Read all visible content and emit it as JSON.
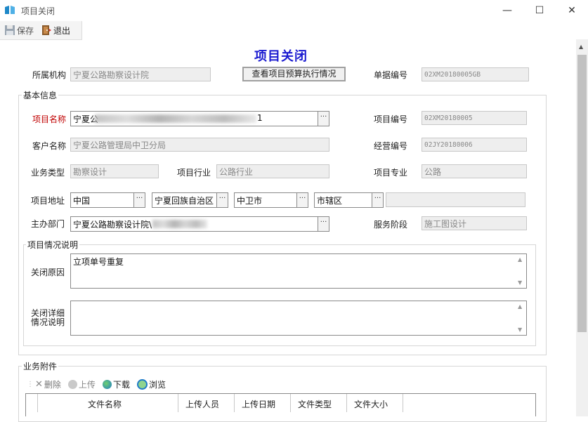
{
  "window": {
    "title": "项目关闭",
    "minimize": "—",
    "maximize": "☐",
    "close": "✕"
  },
  "toolbar": {
    "save_label": "保存",
    "exit_label": "退出"
  },
  "form": {
    "title": "项目关闭",
    "org_label": "所属机构",
    "org_value": "宁夏公路勘察设计院",
    "budget_button": "查看项目预算执行情况",
    "doc_no_label": "单据编号",
    "doc_no_value": "02XM20180005GB",
    "basic_group": "基本信息",
    "project_name_label": "项目名称",
    "project_name_value": "宁夏公",
    "project_name_tail": "1",
    "project_no_label": "项目编号",
    "project_no_value": "02XM20180005",
    "customer_label": "客户名称",
    "customer_value": "宁夏公路管理局中卫分局",
    "biz_no_label": "经营编号",
    "biz_no_value": "02JY20180006",
    "biz_type_label": "业务类型",
    "biz_type_value": "勘察设计",
    "industry_label": "项目行业",
    "industry_value": "公路行业",
    "specialty_label": "项目专业",
    "specialty_value": "公路",
    "address_label": "项目地址",
    "country": "中国",
    "province": "宁夏回族自治区",
    "city": "中卫市",
    "district": "市辖区",
    "dept_label": "主办部门",
    "dept_value": "宁夏公路勘察设计院\\",
    "stage_label": "服务阶段",
    "stage_value": "施工图设计",
    "desc_group": "项目情况说明",
    "close_reason_label": "关闭原因",
    "close_reason_value": "立项单号重复",
    "close_detail_label": "关闭详细情况说明",
    "close_detail_value": ""
  },
  "attachments": {
    "group": "业务附件",
    "delete_label": "删除",
    "upload_label": "上传",
    "download_label": "下载",
    "browse_label": "浏览",
    "columns": [
      "文件名称",
      "上传人员",
      "上传日期",
      "文件类型",
      "文件大小"
    ]
  },
  "colors": {
    "title_blue": "#1a1ad0",
    "required_red": "#c00000"
  }
}
